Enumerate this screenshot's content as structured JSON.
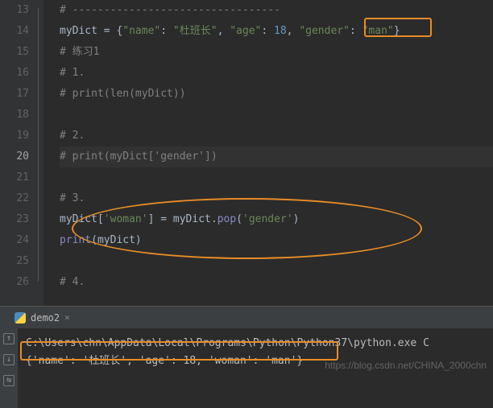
{
  "lines": {
    "l13": "# ---------------------------------",
    "l14_pre": "myDict = {",
    "l14_k1": "\"name\"",
    "l14_v1": "\"杜班长\"",
    "l14_k2": "\"age\"",
    "l14_v2": "18",
    "l14_k3": "\"gender\"",
    "l14_v3": "\"man\"",
    "l15": "# 练习1",
    "l16": "# 1.",
    "l17": "# print(len(myDict))",
    "l19": "# 2.",
    "l20": "# print(myDict['gender'])",
    "l22": "# 3.",
    "l23_a": "myDict[",
    "l23_b": "'woman'",
    "l23_c": "] = myDict.",
    "l23_d": "pop",
    "l23_e": "(",
    "l23_f": "'gender'",
    "l23_g": ")",
    "l24_a": "print",
    "l24_b": "(myDict)",
    "l26": "# 4."
  },
  "lineNumbers": [
    "13",
    "14",
    "15",
    "16",
    "17",
    "18",
    "19",
    "20",
    "21",
    "22",
    "23",
    "24",
    "25",
    "26"
  ],
  "currentLine": "20",
  "tab": {
    "label": "demo2",
    "close": "×"
  },
  "console": {
    "line1": "C:\\Users\\chn\\AppData\\Local\\Programs\\Python\\Python37\\python.exe C",
    "line2": "{'name': '杜班长', 'age': 18, 'woman': 'man'}"
  },
  "watermark": "https://blog.csdn.net/CHINA_2000chn",
  "icons": {
    "up": "↑",
    "down": "↓",
    "wrap": "⇆"
  }
}
